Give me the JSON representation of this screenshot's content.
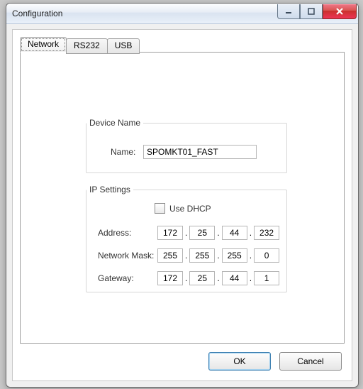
{
  "window": {
    "title": "Configuration"
  },
  "tabs": [
    {
      "label": "Network",
      "active": true
    },
    {
      "label": "RS232",
      "active": false
    },
    {
      "label": "USB",
      "active": false
    }
  ],
  "device_name": {
    "legend": "Device Name",
    "name_label": "Name:",
    "name_value": "SPOMKT01_FAST"
  },
  "ip_settings": {
    "legend": "IP Settings",
    "use_dhcp_label": "Use DHCP",
    "use_dhcp_checked": false,
    "address_label": "Address:",
    "address": [
      "172",
      "25",
      "44",
      "232"
    ],
    "mask_label": "Network Mask:",
    "mask": [
      "255",
      "255",
      "255",
      "0"
    ],
    "gateway_label": "Gateway:",
    "gateway": [
      "172",
      "25",
      "44",
      "1"
    ]
  },
  "buttons": {
    "ok": "OK",
    "cancel": "Cancel"
  }
}
